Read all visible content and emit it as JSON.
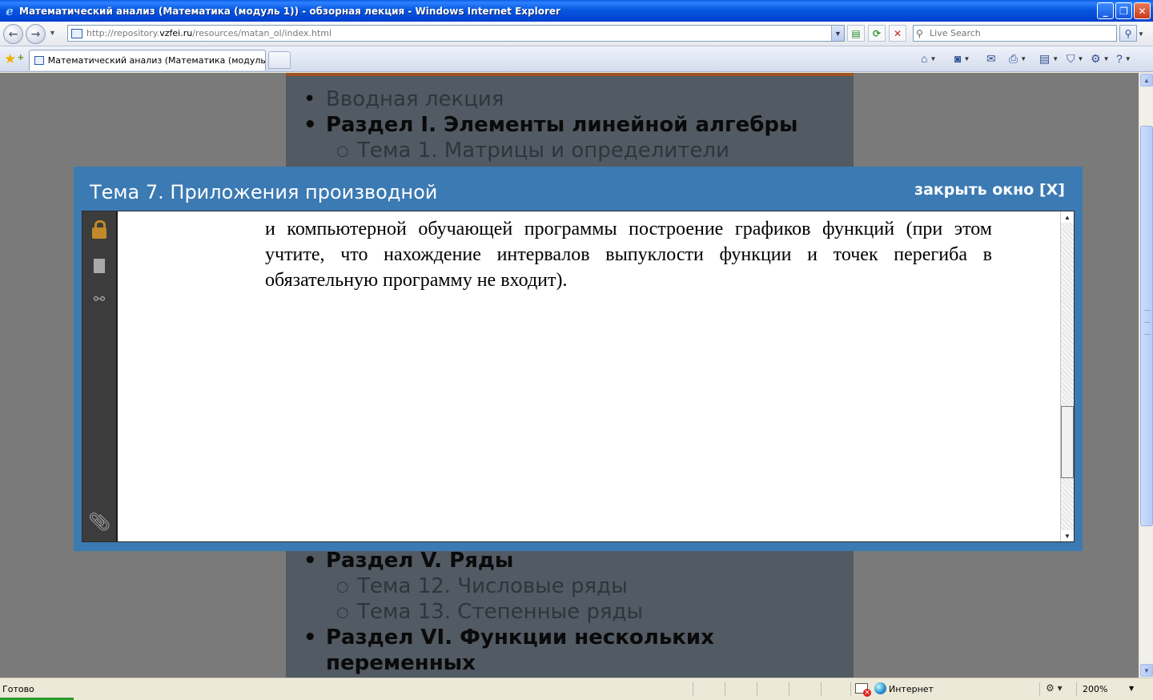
{
  "window": {
    "title": "Математический анализ (Математика (модуль 1)) - обзорная лекция - Windows Internet Explorer",
    "minimize_label": "_",
    "maximize_label": "❐",
    "close_label": "✕"
  },
  "address_bar": {
    "url_prefix": "http://repository.",
    "url_domain": "vzfei.ru",
    "url_suffix": "/resources/matan_ol/index.html",
    "search_placeholder": "Live Search"
  },
  "tabs": [
    {
      "label": "Математический анализ (Математика (модуль 1)) ..."
    }
  ],
  "page": {
    "outline_top": [
      {
        "kind": "intro",
        "label": "Вводная лекция"
      },
      {
        "kind": "sec",
        "label": "Раздел I. Элементы линейной алгебры"
      },
      {
        "kind": "topic",
        "label": "Тема 1. Матрицы и определители"
      }
    ],
    "outline_bottom": [
      {
        "kind": "sec",
        "label": "Раздел V. Ряды"
      },
      {
        "kind": "topic",
        "label": "Тема 12. Числовые ряды"
      },
      {
        "kind": "topic",
        "label": "Тема 13. Степенные ряды"
      },
      {
        "kind": "sec",
        "label": "Раздел VI. Функции нескольких"
      },
      {
        "kind": "sec-cont",
        "label": "переменных"
      }
    ]
  },
  "modal": {
    "title": "Тема 7. Приложения производной",
    "close_label": "закрыть окно [X]",
    "text_lines": [
      "и компьютерной обучающей программы построение графиков функций (при этом",
      "учтите, что нахождение интервалов выпуклости функции и точек перегиба в",
      "обязательную программу не входит)."
    ],
    "pdf_scroll_position": 0.78
  },
  "browser_scroll": {
    "position": 0.22
  },
  "status_bar": {
    "status": "Готово",
    "zone": "Интернет",
    "zoom": "200%"
  }
}
